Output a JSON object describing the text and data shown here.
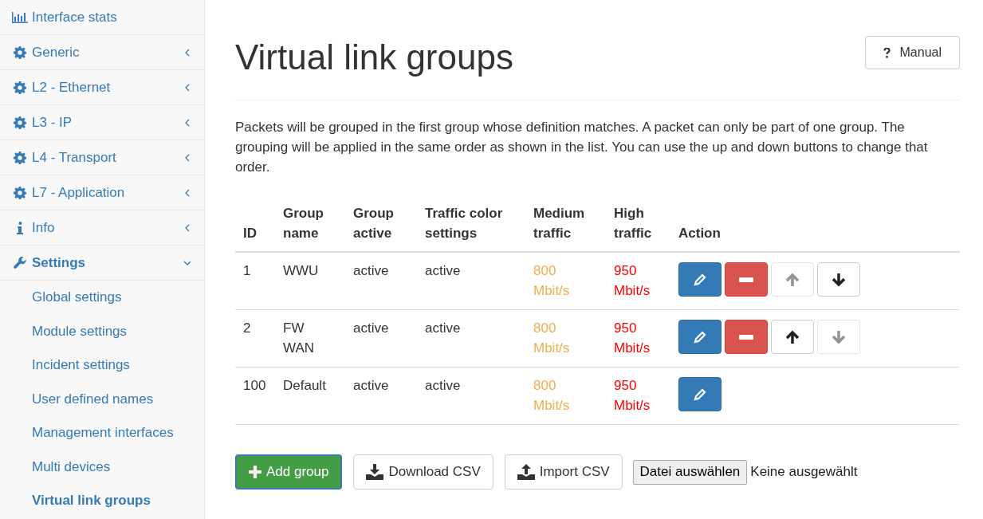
{
  "sidebar": {
    "items": [
      {
        "label": "Interface stats",
        "kind": "link"
      },
      {
        "label": "Generic",
        "kind": "menu",
        "expanded": false
      },
      {
        "label": "L2 - Ethernet",
        "kind": "menu",
        "expanded": false
      },
      {
        "label": "L3 - IP",
        "kind": "menu",
        "expanded": false
      },
      {
        "label": "L4 - Transport",
        "kind": "menu",
        "expanded": false
      },
      {
        "label": "L7 - Application",
        "kind": "menu",
        "expanded": false
      },
      {
        "label": "Info",
        "kind": "menu",
        "expanded": false
      },
      {
        "label": "Settings",
        "kind": "menu",
        "expanded": true,
        "children": [
          {
            "label": "Global settings",
            "selected": false
          },
          {
            "label": "Module settings",
            "selected": false
          },
          {
            "label": "Incident settings",
            "selected": false
          },
          {
            "label": "User defined names",
            "selected": false
          },
          {
            "label": "Management interfaces",
            "selected": false
          },
          {
            "label": "Multi devices",
            "selected": false
          },
          {
            "label": "Virtual link groups",
            "selected": true
          }
        ]
      }
    ]
  },
  "page": {
    "title": "Virtual link groups",
    "manual_button": "Manual",
    "description": "Packets will be grouped in the first group whose definition matches. A packet can only be part of one group. The grouping will be applied in the same order as shown in the list. You can use the up and down buttons to change that order."
  },
  "table": {
    "columns": [
      "ID",
      "Group name",
      "Group active",
      "Traffic color settings",
      "Medium traffic",
      "High traffic",
      "Action"
    ],
    "rows": [
      {
        "id": "1",
        "name": "WWU",
        "active": "active",
        "color_settings": "active",
        "medium": "800 Mbit/s",
        "high": "950 Mbit/s",
        "actions": [
          {
            "kind": "edit",
            "disabled": false
          },
          {
            "kind": "delete",
            "disabled": false
          },
          {
            "kind": "up",
            "disabled": true
          },
          {
            "kind": "down",
            "disabled": false
          }
        ]
      },
      {
        "id": "2",
        "name": "FW WAN",
        "active": "active",
        "color_settings": "active",
        "medium": "800 Mbit/s",
        "high": "950 Mbit/s",
        "actions": [
          {
            "kind": "edit",
            "disabled": false
          },
          {
            "kind": "delete",
            "disabled": false
          },
          {
            "kind": "up",
            "disabled": false
          },
          {
            "kind": "down",
            "disabled": true
          }
        ]
      },
      {
        "id": "100",
        "name": "Default",
        "active": "active",
        "color_settings": "active",
        "medium": "800 Mbit/s",
        "high": "950 Mbit/s",
        "actions": [
          {
            "kind": "edit",
            "disabled": false
          }
        ]
      }
    ]
  },
  "footer": {
    "add_button": "Add group",
    "download_button": "Download CSV",
    "import_button": "Import CSV",
    "file_button": "Datei auswählen",
    "file_status": "Keine ausgewählt"
  }
}
